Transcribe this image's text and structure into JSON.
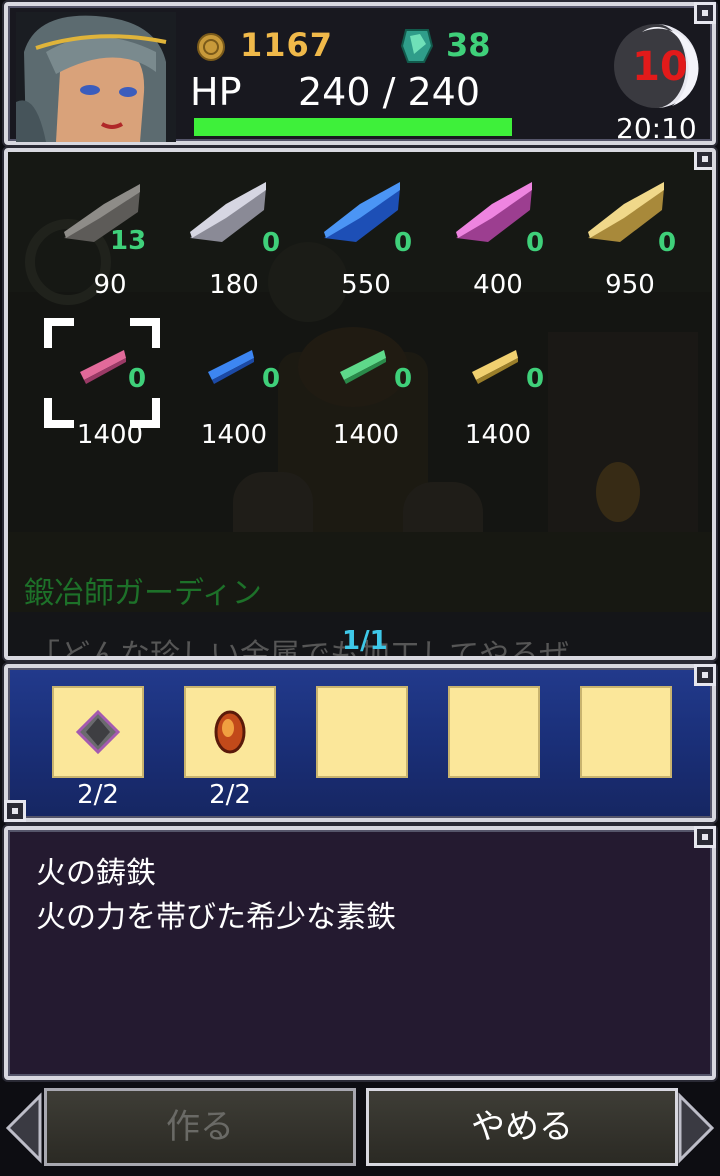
{
  "status": {
    "coins": "1167",
    "gems": "38",
    "hp_label": "HP",
    "hp_value": "240 / 240",
    "hp_fraction": 1.0,
    "moon_number": "10",
    "clock": "20:10"
  },
  "forge": {
    "items": [
      {
        "count": "13",
        "price": "90",
        "color": "#8e8c88"
      },
      {
        "count": "0",
        "price": "180",
        "color": "#c9c9d6"
      },
      {
        "count": "0",
        "price": "550",
        "color": "#2f7cf0"
      },
      {
        "count": "0",
        "price": "400",
        "color": "#e06fd4"
      },
      {
        "count": "0",
        "price": "950",
        "color": "#e8c96a"
      },
      {
        "count": "0",
        "price": "1400",
        "color": "#e26a9a"
      },
      {
        "count": "0",
        "price": "1400",
        "color": "#2f7cf0"
      },
      {
        "count": "0",
        "price": "1400",
        "color": "#4fd07a"
      },
      {
        "count": "0",
        "price": "1400",
        "color": "#e8c96a"
      }
    ],
    "npc_name": "鍛冶師ガーディン",
    "dialog": "「どんな珍しい金属でも加工してやるぜ。",
    "page": "1/1"
  },
  "materials": {
    "slots": [
      {
        "count": "2/2",
        "icon": "dark-ore-icon"
      },
      {
        "count": "2/2",
        "icon": "fire-gem-icon"
      },
      {
        "count": "",
        "icon": ""
      },
      {
        "count": "",
        "icon": ""
      },
      {
        "count": "",
        "icon": ""
      }
    ]
  },
  "description": {
    "title": "火の鋳鉄",
    "text": "火の力を帯びた希少な素鉄"
  },
  "buttons": {
    "make": "作る",
    "quit": "やめる"
  }
}
